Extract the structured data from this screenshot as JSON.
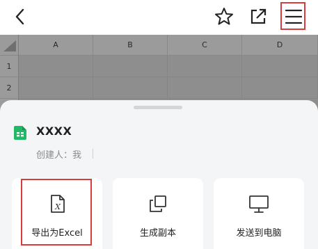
{
  "topbar": {
    "back_icon": "chevron-left-icon",
    "star_icon": "star-outline-icon",
    "share_icon": "open-external-icon",
    "menu_icon": "hamburger-menu-icon"
  },
  "sheet": {
    "columns": [
      "A",
      "B",
      "C",
      "D"
    ],
    "rows": [
      "1",
      "2"
    ]
  },
  "panel": {
    "file_name": "XXXX",
    "creator_label": "创建人：我",
    "actions": [
      {
        "label": "导出为Excel",
        "icon": "excel-file-icon"
      },
      {
        "label": "生成副本",
        "icon": "copy-icon"
      },
      {
        "label": "发送到电脑",
        "icon": "monitor-icon"
      }
    ]
  },
  "colors": {
    "highlight": "#d73b3b",
    "file_icon": "#1fba66",
    "panel_bg": "#f4f5f7"
  }
}
